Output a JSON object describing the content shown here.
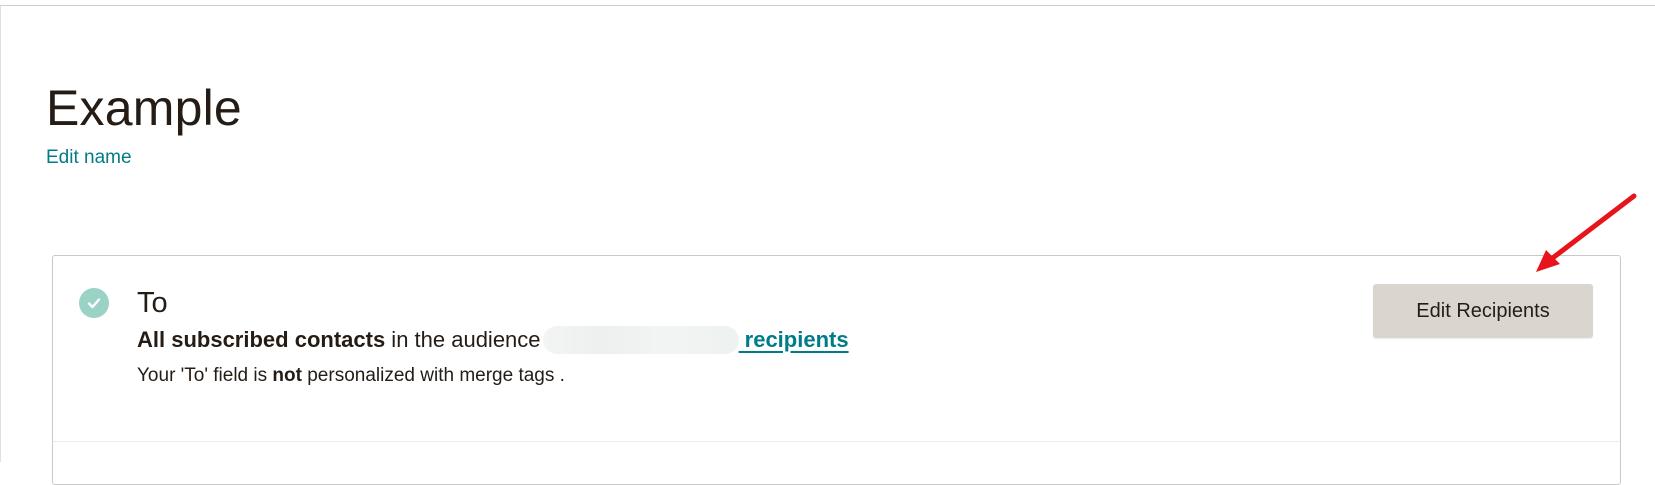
{
  "campaign": {
    "title": "Example",
    "edit_name_label": "Edit name"
  },
  "to_section": {
    "heading": "To",
    "audience_prefix": "All subscribed contacts",
    "audience_middle": " in the audience",
    "recipients_label": " recipients",
    "merge_prefix": "Your 'To' field is ",
    "merge_emphasis": "not",
    "merge_suffix": " personalized with merge tags .",
    "edit_button_label": "Edit Recipients"
  },
  "colors": {
    "link": "#007c89",
    "check_badge": "#9bd2c6",
    "button_bg": "#dad6cf",
    "annotation_arrow": "#e8141c"
  },
  "icons": {
    "status": "check-circle-icon",
    "annotation": "red-arrow-icon"
  }
}
